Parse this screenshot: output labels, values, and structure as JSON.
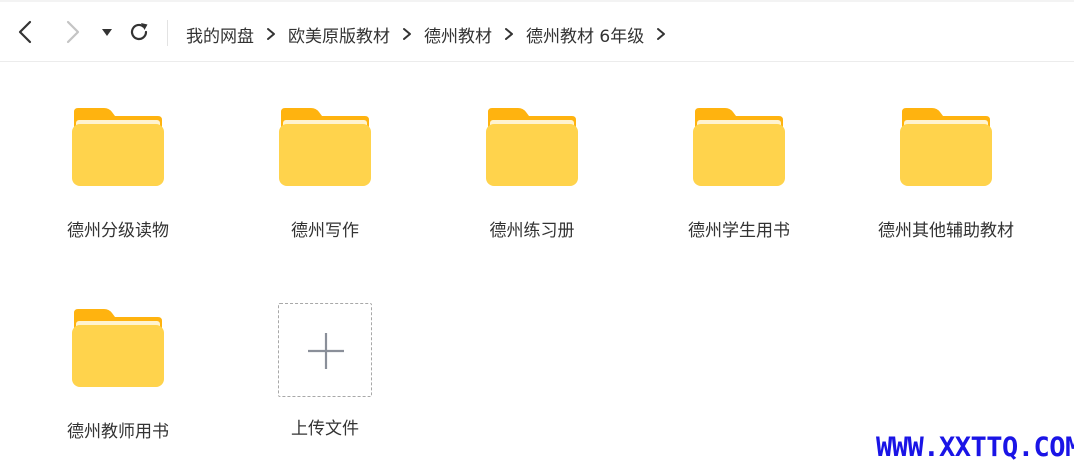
{
  "breadcrumb": {
    "items": [
      "我的网盘",
      "欧美原版教材",
      "德州教材",
      "德州教材 6年级"
    ]
  },
  "folders": [
    {
      "name": "德州分级读物"
    },
    {
      "name": "德州写作"
    },
    {
      "name": "德州练习册"
    },
    {
      "name": "德州学生用书"
    },
    {
      "name": "德州其他辅助教材"
    },
    {
      "name": "德州教师用书"
    }
  ],
  "upload": {
    "label": "上传文件"
  },
  "icons": {
    "back": "chevron-left-icon",
    "forward": "chevron-right-icon",
    "history": "caret-down-icon",
    "refresh": "refresh-icon",
    "folder": "folder-icon",
    "upload": "plus-icon"
  },
  "colors": {
    "folder_front": "#ffd34c",
    "folder_back": "#ffb30f",
    "watermark": "#1a14e6"
  },
  "watermark": "WWW.XXTTQ.COM"
}
